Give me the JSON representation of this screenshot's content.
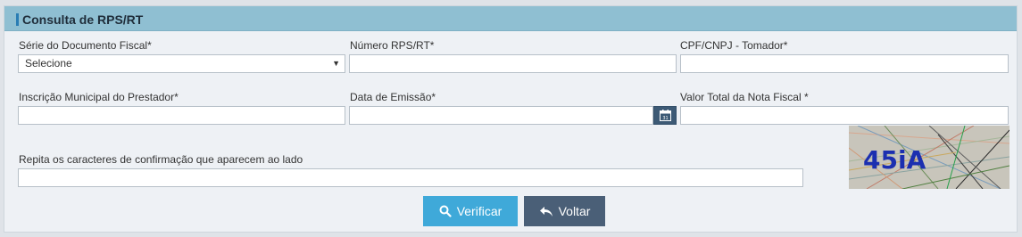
{
  "panel": {
    "title": "Consulta de RPS/RT"
  },
  "fields": {
    "serie": {
      "label": "Série do Documento Fiscal*",
      "value": "Selecione"
    },
    "numero": {
      "label": "Número RPS/RT*",
      "value": ""
    },
    "cpf_cnpj": {
      "label": "CPF/CNPJ - Tomador*",
      "value": ""
    },
    "inscricao": {
      "label": "Inscrição Municipal do Prestador*",
      "value": ""
    },
    "data_emissao": {
      "label": "Data de Emissão*",
      "value": ""
    },
    "valor_total": {
      "label": "Valor Total da Nota Fiscal *",
      "value": ""
    },
    "captcha": {
      "label": "Repita os caracteres de confirmação que aparecem ao lado",
      "value": ""
    }
  },
  "captcha_image": {
    "text": "45iA"
  },
  "buttons": {
    "verify": "Verificar",
    "back": "Voltar"
  },
  "icons": {
    "calendar": "calendar-icon",
    "search": "search-icon",
    "back": "undo-arrow-icon",
    "dropdown": "caret-down-icon"
  },
  "colors": {
    "header": "#8fbfd2",
    "accent_bar": "#2a7db4",
    "verify": "#3fa9d9",
    "back": "#4a5f77"
  }
}
